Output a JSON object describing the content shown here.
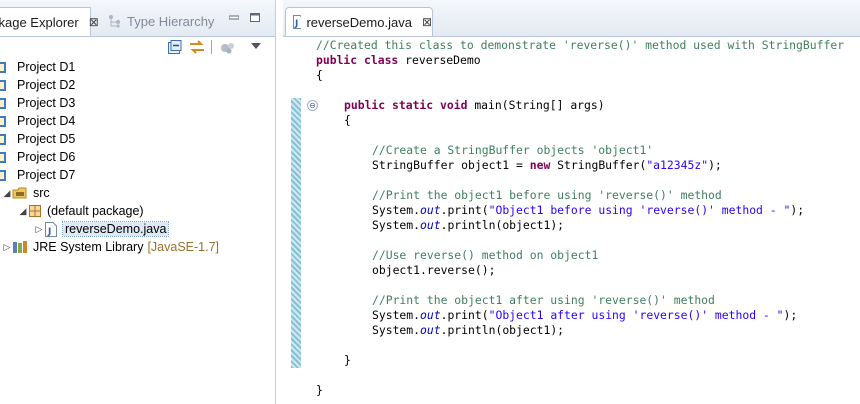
{
  "left_panel": {
    "tabs": [
      {
        "label": "ckage Explorer",
        "close": "⊠"
      },
      {
        "label": "Type Hierarchy"
      }
    ],
    "toolbar_icons": [
      "collapse-all-icon",
      "link-with-editor-icon",
      "view-menu-icon",
      "dropdown-icon"
    ],
    "projects": [
      "Project D1",
      "Project D2",
      "Project D3",
      "Project D4",
      "Project D5",
      "Project D6",
      "Project D7"
    ],
    "tree": {
      "src": "src",
      "package": "(default package)",
      "file": "reverseDemo.java",
      "jre": "JRE System Library",
      "jre_version": "[JavaSE-1.7]"
    }
  },
  "editor": {
    "tab_label": "reverseDemo.java",
    "tab_close": "⊠",
    "code": {
      "l1": "//Created this class to demonstrate 'reverse()' method used with StringBuffer",
      "l2_kw": "public class ",
      "l2_name": "reverseDemo",
      "l3": "{",
      "l5_kw": "public static void ",
      "l5_rest": "main(String[] args)",
      "l6": "{",
      "l8": "//Create a StringBuffer objects 'object1'",
      "l9_a": "StringBuffer object1 = ",
      "l9_kw": "new",
      "l9_b": " StringBuffer(",
      "l9_str": "\"a12345z\"",
      "l9_c": ");",
      "l11": "//Print the object1 before using 'reverse()' method",
      "l12_a": "System.",
      "l12_field": "out",
      "l12_b": ".print(",
      "l12_str": "\"Object1 before using 'reverse()' method - \"",
      "l12_c": ");",
      "l13_a": "System.",
      "l13_field": "out",
      "l13_b": ".println(object1);",
      "l15": "//Use reverse() method on object1",
      "l16": "object1.reverse();",
      "l18": "//Print the object1 after using 'reverse()' method",
      "l19_a": "System.",
      "l19_field": "out",
      "l19_b": ".print(",
      "l19_str": "\"Object1 after using 'reverse()' method - \"",
      "l19_c": ");",
      "l20_a": "System.",
      "l20_field": "out",
      "l20_b": ".println(object1);",
      "l22": "}",
      "l24": "}"
    }
  }
}
